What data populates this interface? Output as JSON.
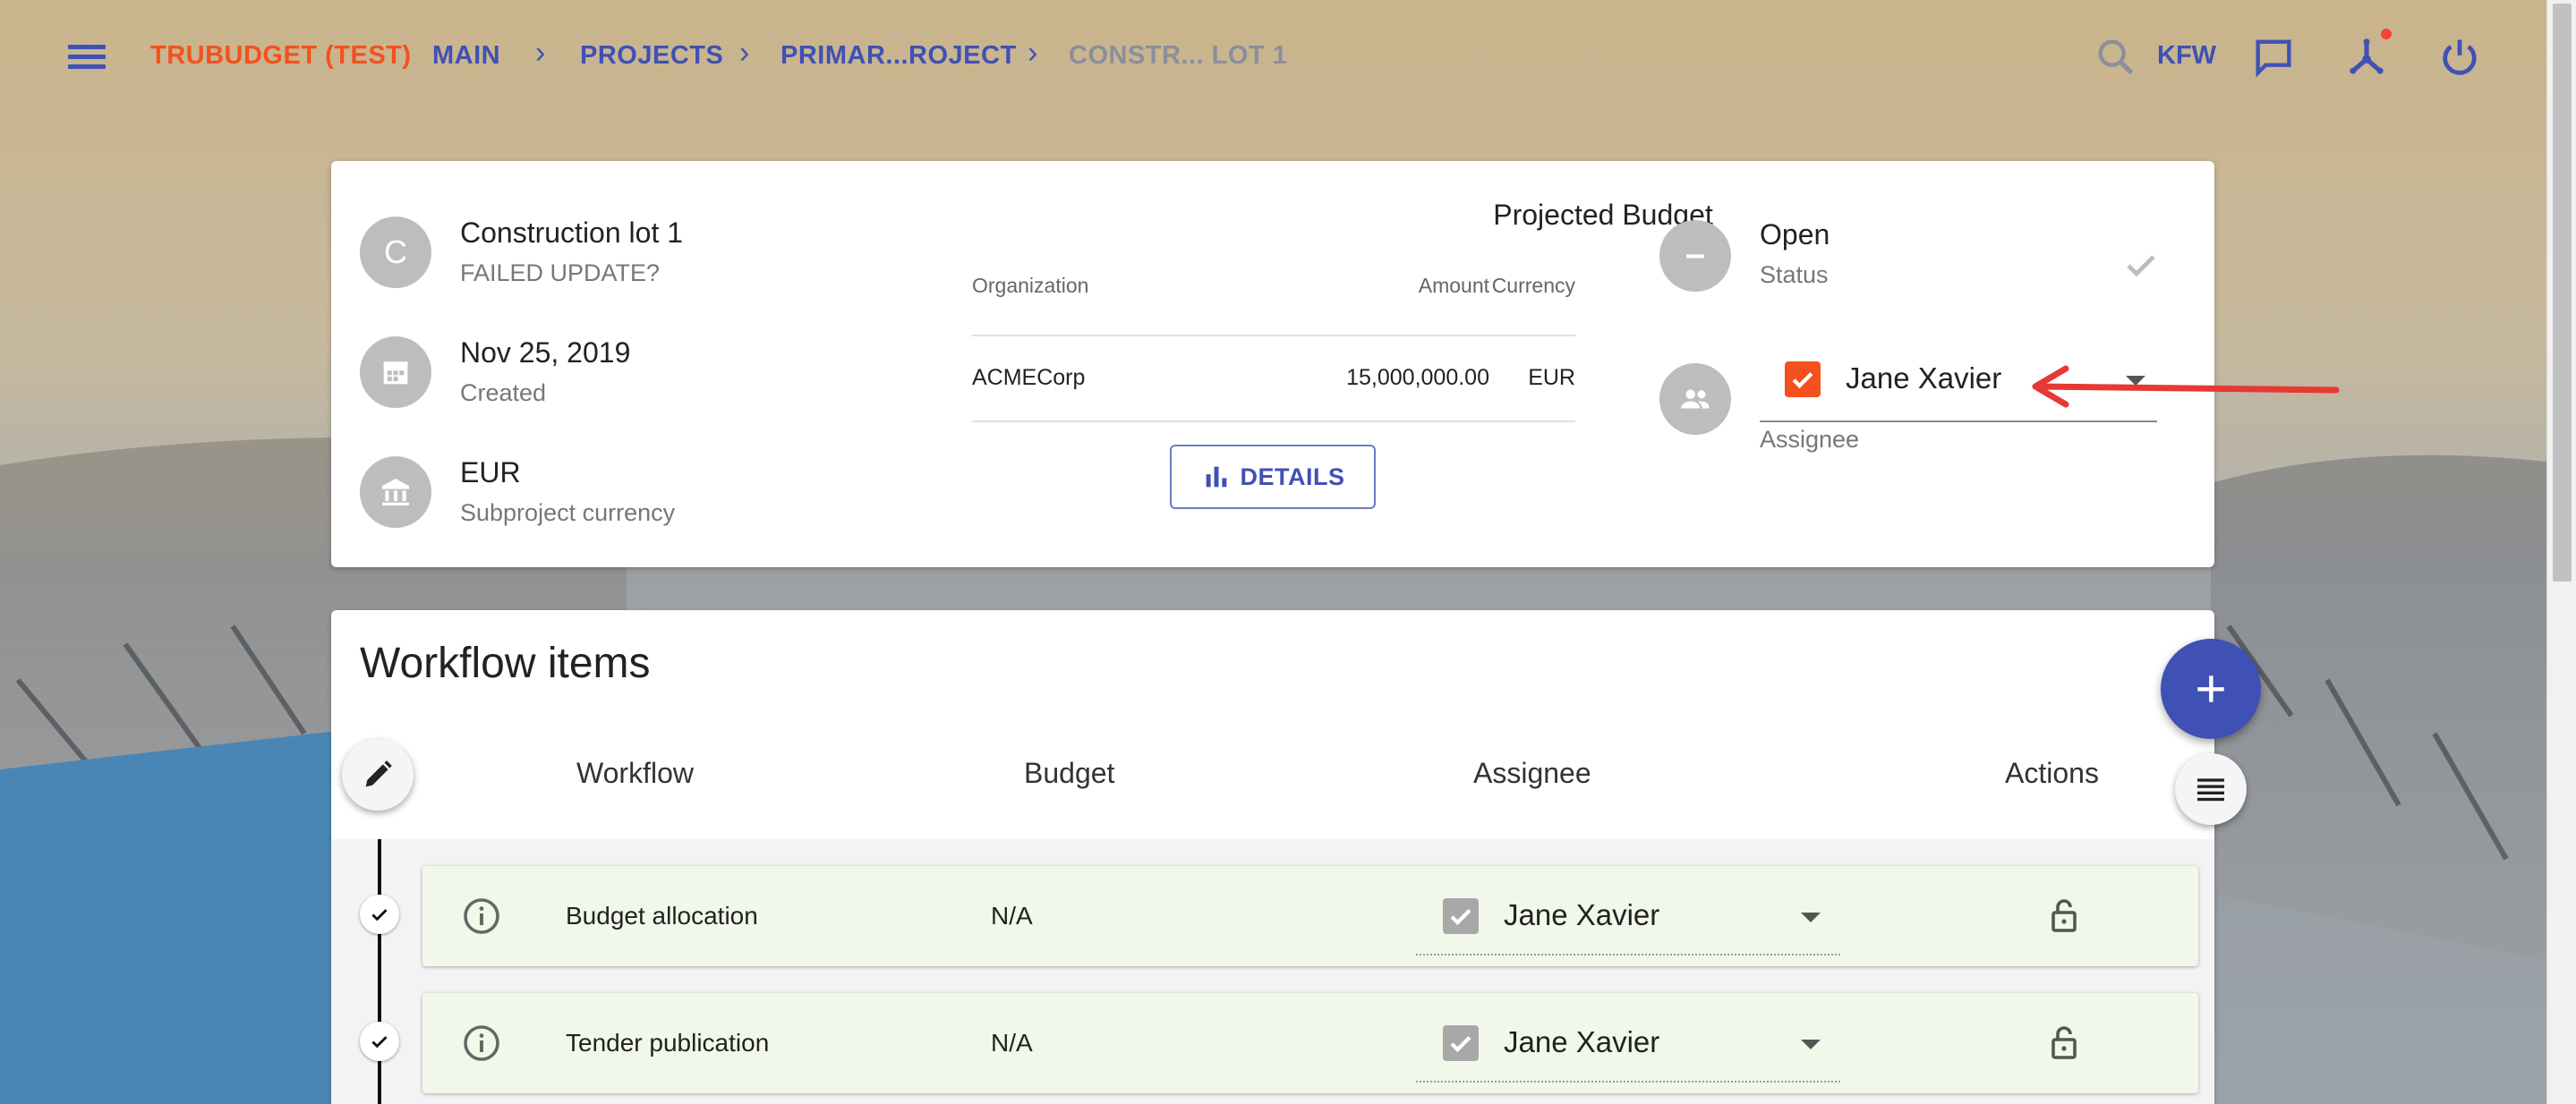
{
  "app": {
    "brand": "TRUBUDGET (TEST)",
    "colors": {
      "primary": "#3f51b5",
      "accent": "#f4511e",
      "row_bg": "#f1f8e9"
    }
  },
  "breadcrumb": [
    {
      "label": "MAIN"
    },
    {
      "label": "PROJECTS"
    },
    {
      "label": "PRIMAR...ROJECT"
    },
    {
      "label": "CONSTR... LOT 1"
    }
  ],
  "topbar": {
    "org": "KFW",
    "icons": [
      "search-icon",
      "chat-icon",
      "network-icon",
      "power-icon"
    ]
  },
  "subproject": {
    "avatar_letter": "C",
    "name": "Construction lot 1",
    "description": "FAILED UPDATE?",
    "created_date": "Nov 25, 2019",
    "created_label": "Created",
    "currency": "EUR",
    "currency_label": "Subproject currency",
    "status": "Open",
    "status_label": "Status",
    "assignee": "Jane Xavier",
    "assignee_label": "Assignee"
  },
  "projected_budget": {
    "title": "Projected Budget",
    "headers": {
      "organization": "Organization",
      "amount": "Amount",
      "currency": "Currency"
    },
    "rows": [
      {
        "organization": "ACMECorp",
        "amount": "15,000,000.00",
        "currency": "EUR"
      }
    ],
    "details_label": "DETAILS"
  },
  "workflow": {
    "title": "Workflow items",
    "headers": {
      "workflow": "Workflow",
      "budget": "Budget",
      "assignee": "Assignee",
      "actions": "Actions"
    },
    "items": [
      {
        "name": "Budget allocation",
        "budget": "N/A",
        "assignee": "Jane Xavier"
      },
      {
        "name": "Tender publication",
        "budget": "N/A",
        "assignee": "Jane Xavier"
      }
    ]
  }
}
